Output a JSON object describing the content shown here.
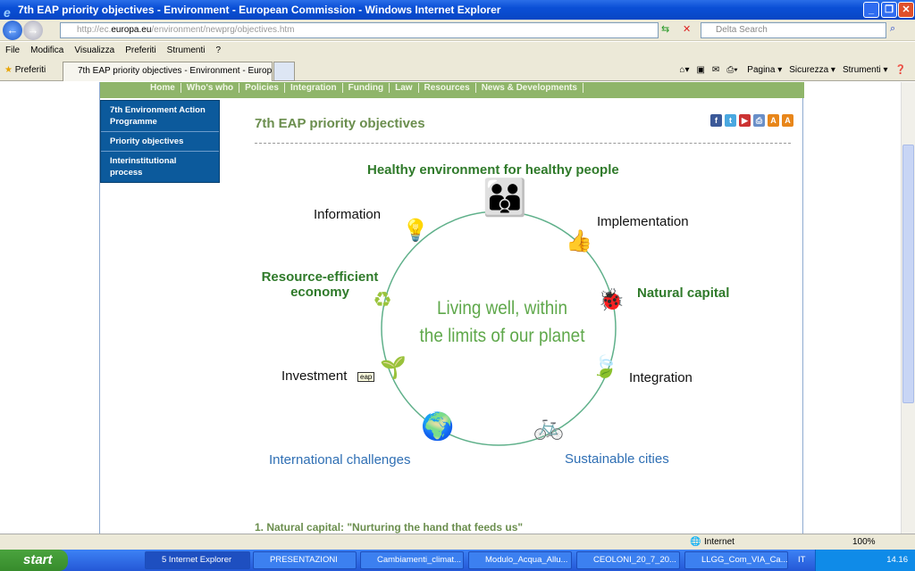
{
  "window": {
    "title": "7th EAP priority objectives - Environment - European Commission - Windows Internet Explorer"
  },
  "address": {
    "prefix": "http://ec.",
    "domain": "europa.eu",
    "path": "/environment/newprg/objectives.htm"
  },
  "search": {
    "placeholder": "Delta Search"
  },
  "menu": [
    "File",
    "Modifica",
    "Visualizza",
    "Preferiti",
    "Strumenti",
    "?"
  ],
  "favorites_label": "Preferiti",
  "tab_title": "7th EAP priority objectives - Environment - European ...",
  "commands": [
    "Pagina ▾",
    "Sicurezza ▾",
    "Strumenti ▾"
  ],
  "topnav": [
    "Home",
    "Who's who",
    "Policies",
    "Integration",
    "Funding",
    "Law",
    "Resources",
    "News & Developments"
  ],
  "leftnav": [
    "7th Environment Action Programme",
    "Priority objectives",
    "Interinstitutional process"
  ],
  "page_title": "7th EAP priority objectives",
  "social_icons": [
    "facebook-icon",
    "twitter-icon",
    "youtube-icon",
    "print-icon",
    "font-small-icon",
    "font-large-icon"
  ],
  "diagram": {
    "center": [
      "Living well, within",
      "the limits of our planet"
    ],
    "healthy": "Healthy environment for healthy people",
    "information": "Information",
    "implementation": "Implementation",
    "resource1": "Resource-efficient",
    "resource2": "economy",
    "natural": "Natural capital",
    "investment": "Investment",
    "integration": "Integration",
    "international": "International challenges",
    "cities": "Sustainable cities",
    "tooltip": "eap"
  },
  "section1": "1. Natural capital: \"Nurturing the hand that feeds us\"",
  "status": {
    "zone": "Internet",
    "zoom": "100%"
  },
  "taskbar": {
    "start": "start",
    "items": [
      "5 Internet Explorer",
      "PRESENTAZIONI",
      "Cambiamenti_climat...",
      "Modulo_Acqua_Allu...",
      "CEOLONI_20_7_20...",
      "LLGG_Com_VIA_Ca..."
    ],
    "lang": "IT",
    "clock": "14.16"
  },
  "colors": {
    "nav_green": "#8fb56a",
    "leftnav_blue": "#0c5a9c",
    "title_green": "#6b8e4e",
    "circle": "#5fb08a"
  }
}
